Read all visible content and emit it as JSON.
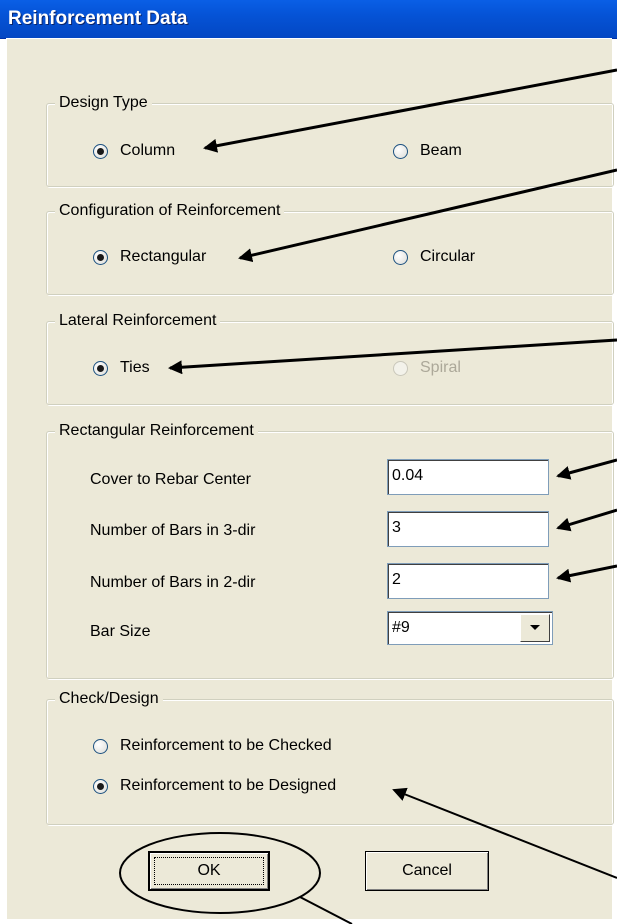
{
  "window": {
    "title": "Reinforcement Data"
  },
  "design_type": {
    "legend": "Design Type",
    "options": [
      {
        "label": "Column",
        "selected": true,
        "enabled": true
      },
      {
        "label": "Beam",
        "selected": false,
        "enabled": true
      }
    ]
  },
  "configuration": {
    "legend": "Configuration of Reinforcement",
    "options": [
      {
        "label": "Rectangular",
        "selected": true,
        "enabled": true
      },
      {
        "label": "Circular",
        "selected": false,
        "enabled": true
      }
    ]
  },
  "lateral": {
    "legend": "Lateral Reinforcement",
    "options": [
      {
        "label": "Ties",
        "selected": true,
        "enabled": true
      },
      {
        "label": "Spiral",
        "selected": false,
        "enabled": false
      }
    ]
  },
  "rectangular": {
    "legend": "Rectangular Reinforcement",
    "fields": [
      {
        "label": "Cover to Rebar Center",
        "value": "0.04"
      },
      {
        "label": "Number of Bars in 3-dir",
        "value": "3"
      },
      {
        "label": "Number of Bars in 2-dir",
        "value": "2"
      }
    ],
    "bar_size": {
      "label": "Bar Size",
      "value": "#9"
    }
  },
  "check_design": {
    "legend": "Check/Design",
    "options": [
      {
        "label": "Reinforcement to be Checked",
        "selected": false,
        "enabled": true
      },
      {
        "label": "Reinforcement to be Designed",
        "selected": true,
        "enabled": true
      }
    ]
  },
  "buttons": {
    "ok": "OK",
    "cancel": "Cancel"
  },
  "icons": {
    "combo_arrow": "chevron-down-icon",
    "annotation_arrow": "arrow-icon"
  },
  "colors": {
    "title_bar": "#0553d6",
    "dialog_bg": "#ece9d8",
    "radio_border": "#1c5180"
  }
}
